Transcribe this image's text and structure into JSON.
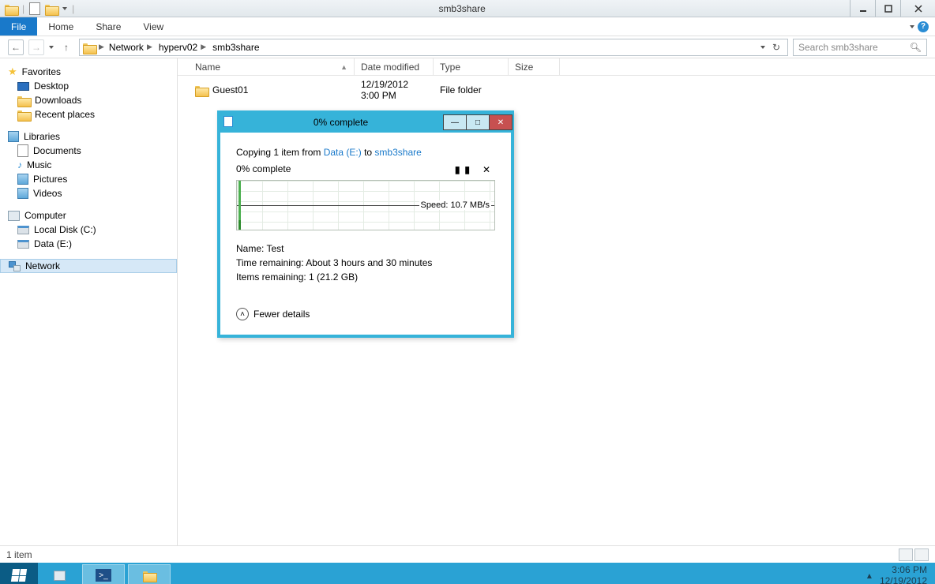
{
  "window": {
    "title": "smb3share"
  },
  "menu": {
    "file": "File",
    "home": "Home",
    "share": "Share",
    "view": "View"
  },
  "nav": {
    "segments": [
      "Network",
      "hyperv02",
      "smb3share"
    ],
    "search_placeholder": "Search smb3share"
  },
  "sidebar": {
    "favorites": {
      "label": "Favorites",
      "items": [
        "Desktop",
        "Downloads",
        "Recent places"
      ]
    },
    "libraries": {
      "label": "Libraries",
      "items": [
        "Documents",
        "Music",
        "Pictures",
        "Videos"
      ]
    },
    "computer": {
      "label": "Computer",
      "items": [
        "Local Disk (C:)",
        "Data (E:)"
      ]
    },
    "network": {
      "label": "Network"
    }
  },
  "columns": {
    "name": "Name",
    "date": "Date modified",
    "type": "Type",
    "size": "Size"
  },
  "files": [
    {
      "name": "Guest01",
      "date": "12/19/2012 3:00 PM",
      "type": "File folder",
      "size": ""
    }
  ],
  "status": {
    "count": "1 item"
  },
  "tray": {
    "time": "3:06 PM",
    "date": "12/19/2012"
  },
  "dialog": {
    "title": "0% complete",
    "copying_prefix": "Copying 1 item from ",
    "source": "Data (E:)",
    "to": " to ",
    "dest": "smb3share",
    "percent": "0% complete",
    "speed": "Speed: 10.7 MB/s",
    "name_label": "Name:  ",
    "name_value": "Test",
    "time_label": "Time remaining:  ",
    "time_value": "About 3 hours and 30 minutes",
    "items_label": "Items remaining:  ",
    "items_value": "1 (21.2 GB)",
    "fewer": "Fewer details"
  }
}
